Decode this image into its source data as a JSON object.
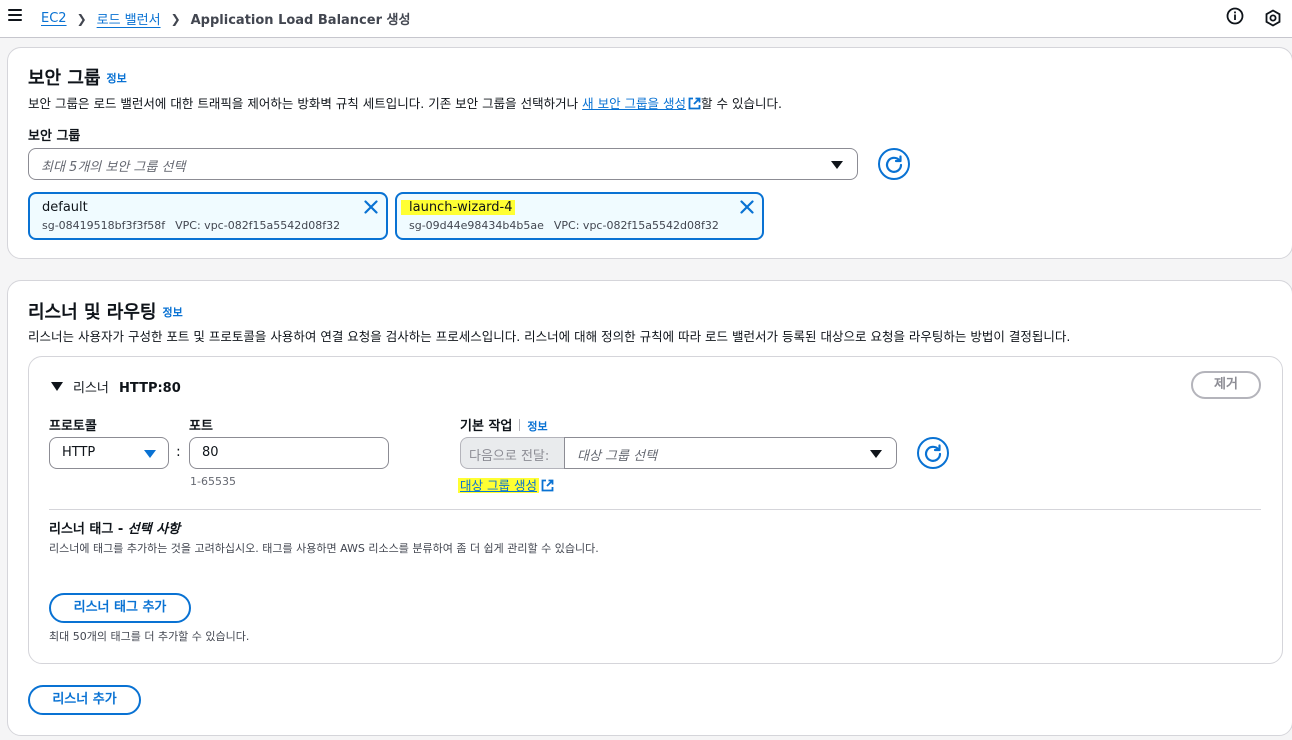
{
  "breadcrumb": {
    "items": [
      "EC2",
      "로드 밸런서"
    ],
    "current": "Application Load Balancer 생성"
  },
  "security_group": {
    "title": "보안 그룹",
    "info": "정보",
    "desc_before": "보안 그룹은 로드 밸런서에 대한 트래픽을 제어하는 방화벽 규칙 세트입니다. 기존 보안 그룹을 선택하거나 ",
    "desc_link": "새 보안 그룹을 생성",
    "desc_after": "할 수 있습니다.",
    "field_label": "보안 그룹",
    "placeholder": "최대 5개의 보안 그룹 선택",
    "tokens": [
      {
        "name": "default",
        "id": "sg-08419518bf3f3f58f",
        "vpc": "VPC: vpc-082f15a5542d08f32"
      },
      {
        "name": "launch-wizard-4",
        "id": "sg-09d44e98434b4b5ae",
        "vpc": "VPC: vpc-082f15a5542d08f32"
      }
    ]
  },
  "listeners": {
    "title": "리스너 및 라우팅",
    "info": "정보",
    "desc": "리스너는 사용자가 구성한 포트 및 프로토콜을 사용하여 연결 요청을 검사하는 프로세스입니다. 리스너에 대해 정의한 규칙에 따라 로드 밸런서가 등록된 대상으로 요청을 라우팅하는 방법이 결정됩니다.",
    "listener": {
      "prefix": "리스너",
      "name": "HTTP:80",
      "remove_label": "제거",
      "protocol_label": "프로토콜",
      "protocol_value": "HTTP",
      "port_label": "포트",
      "colon": ":",
      "port_value": "80",
      "port_hint": "1-65535",
      "default_action_label": "기본 작업",
      "default_action_info": "정보",
      "forward_label": "다음으로 전달:",
      "target_placeholder": "대상 그룹 선택",
      "create_target_link": "대상 그룹 생성",
      "tags_title": "리스너 태그 - ",
      "tags_title_optional": "선택 사항",
      "tags_desc": "리스너에 태그를 추가하는 것을 고려하십시오. 태그를 사용하면 AWS 리소스를 분류하여 좀 더 쉽게 관리할 수 있습니다.",
      "add_tag_label": "리스너 태그 추가",
      "tag_limit": "최대 50개의 태그를 더 추가할 수 있습니다."
    },
    "add_listener_label": "리스너 추가"
  },
  "icons": {
    "menu": "hamburger-icon",
    "info": "info-circle-icon",
    "settings": "hexagon-settings-icon",
    "refresh": "refresh-icon",
    "remove": "close-icon",
    "external": "external-link-icon",
    "expand": "caret-down-icon"
  },
  "colors": {
    "accent": "#0972d3",
    "highlight": "#ffff33",
    "token_bg": "#f0fbff"
  }
}
